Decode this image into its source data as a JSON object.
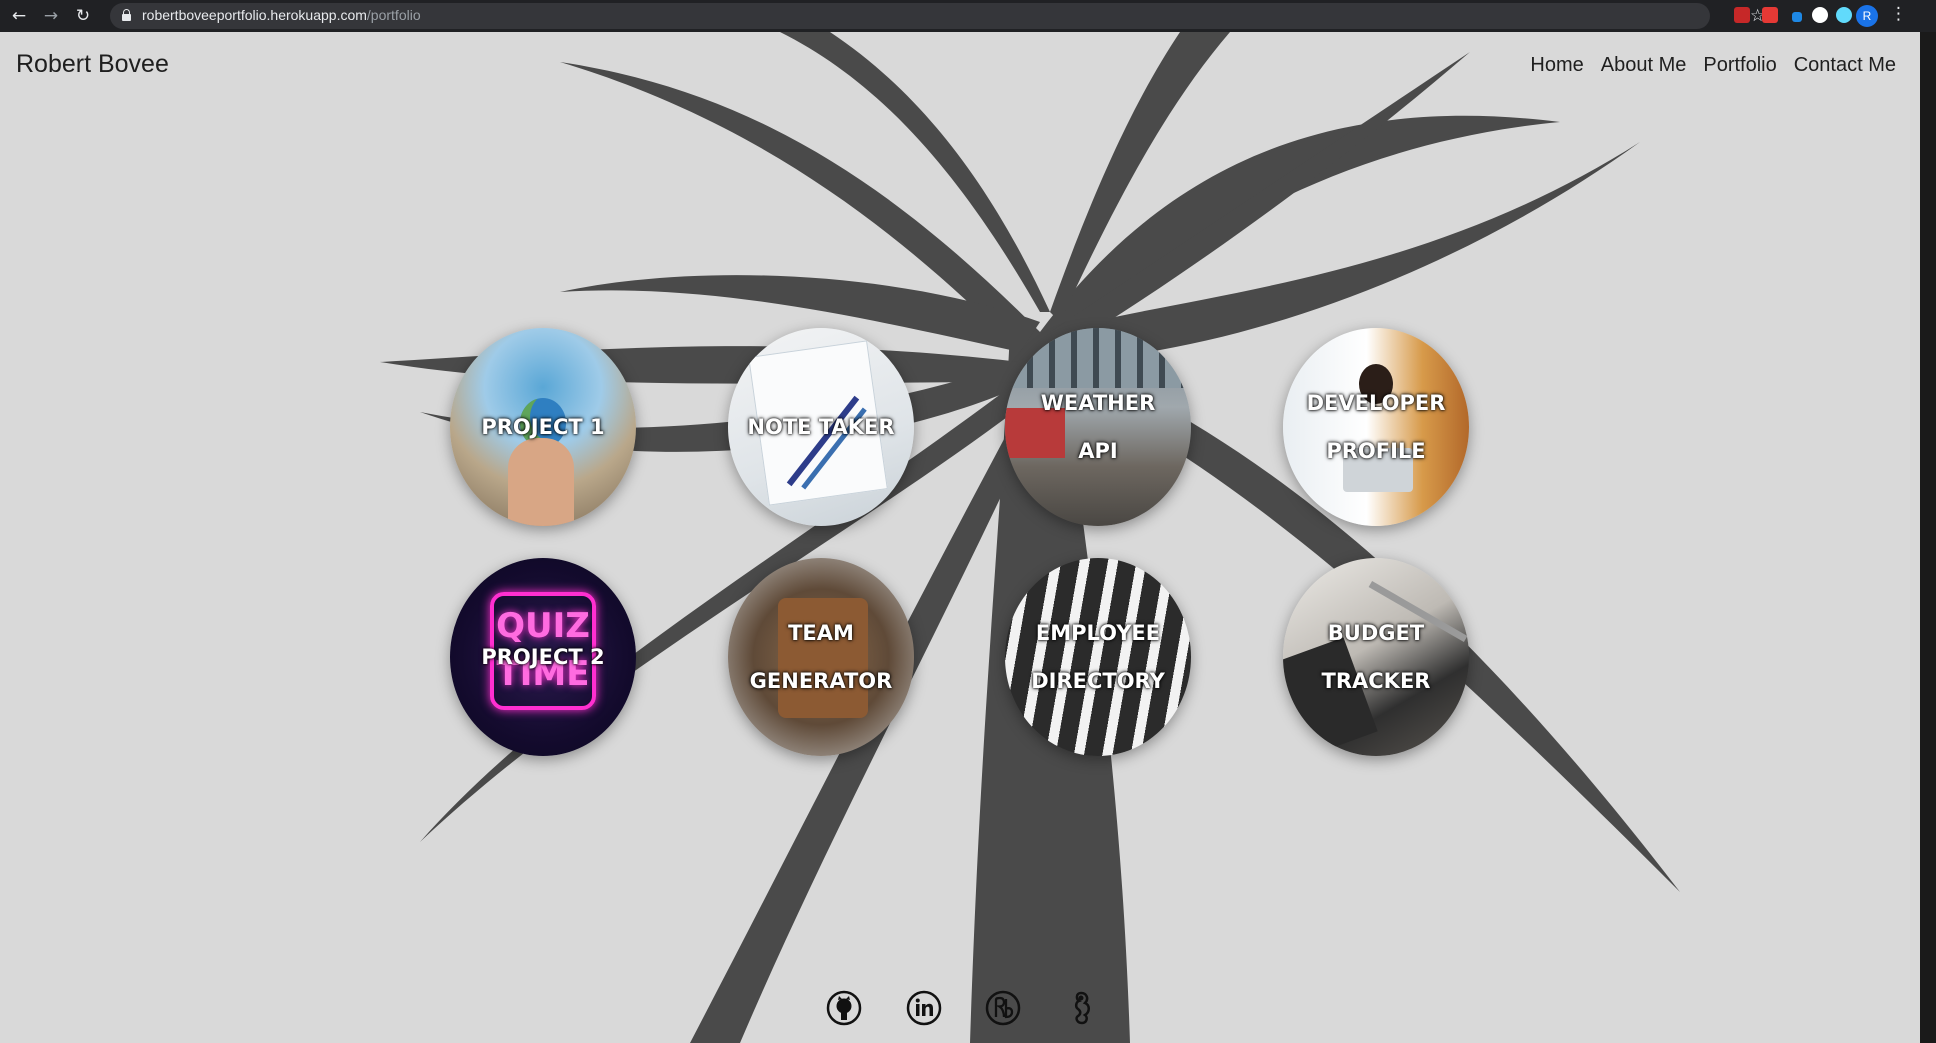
{
  "browser": {
    "url_host": "robertboveeportfolio.herokuapp.com",
    "url_path": "/portfolio",
    "profile_initial": "R"
  },
  "site": {
    "brand": "Robert Bovee",
    "nav": [
      "Home",
      "About Me",
      "Portfolio",
      "Contact Me"
    ]
  },
  "projects": [
    {
      "title": "PROJECT 1"
    },
    {
      "title": "NOTE TAKER"
    },
    {
      "title": "WEATHER API"
    },
    {
      "title": "DEVELOPER PROFILE"
    },
    {
      "title": "PROJECT 2",
      "image_text": "QUIZ TIME"
    },
    {
      "title": "TEAM GENERATOR"
    },
    {
      "title": "EMPLOYEE DIRECTORY"
    },
    {
      "title": "BUDGET TRACKER"
    }
  ],
  "social": [
    "github-icon",
    "linkedin-icon",
    "resume-icon",
    "stackoverflow-icon"
  ]
}
